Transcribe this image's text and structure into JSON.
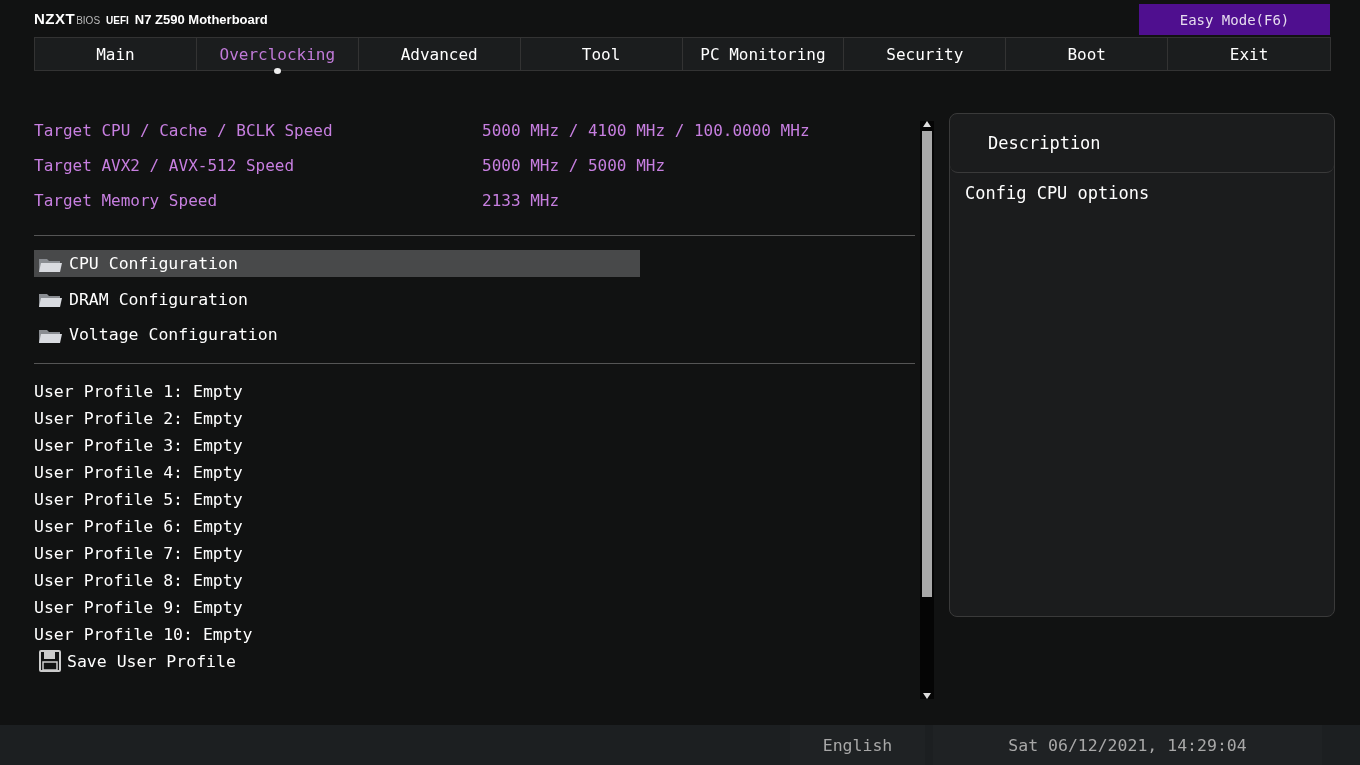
{
  "header": {
    "brand": "NZXT",
    "bios": "BIOS",
    "uefi": "UEFI",
    "board": "N7 Z590 Motherboard",
    "easy_mode_button": "Easy Mode(F6)"
  },
  "tabs": [
    {
      "label": "Main",
      "selected": false
    },
    {
      "label": "Overclocking",
      "selected": true
    },
    {
      "label": "Advanced",
      "selected": false
    },
    {
      "label": "Tool",
      "selected": false
    },
    {
      "label": "PC Monitoring",
      "selected": false
    },
    {
      "label": "Security",
      "selected": false
    },
    {
      "label": "Boot",
      "selected": false
    },
    {
      "label": "Exit",
      "selected": false
    }
  ],
  "info_rows": [
    {
      "label": "Target CPU / Cache / BCLK Speed",
      "value": "5000 MHz / 4100 MHz / 100.0000 MHz"
    },
    {
      "label": "Target AVX2 / AVX-512 Speed",
      "value": "5000 MHz / 5000 MHz"
    },
    {
      "label": "Target Memory Speed",
      "value": "2133 MHz"
    }
  ],
  "submenus": [
    {
      "label": "CPU Configuration",
      "selected": true
    },
    {
      "label": "DRAM Configuration",
      "selected": false
    },
    {
      "label": "Voltage Configuration",
      "selected": false
    }
  ],
  "profile_items": [
    {
      "kind": "text",
      "label": "User Profile 1: Empty"
    },
    {
      "kind": "text",
      "label": "User Profile 2: Empty"
    },
    {
      "kind": "text",
      "label": "User Profile 3: Empty"
    },
    {
      "kind": "text",
      "label": "User Profile 4: Empty"
    },
    {
      "kind": "text",
      "label": "User Profile 5: Empty"
    },
    {
      "kind": "text",
      "label": "User Profile 6: Empty"
    },
    {
      "kind": "text",
      "label": "User Profile 7: Empty"
    },
    {
      "kind": "text",
      "label": "User Profile 8: Empty"
    },
    {
      "kind": "text",
      "label": "User Profile 9: Empty"
    },
    {
      "kind": "text",
      "label": "User Profile 10: Empty"
    },
    {
      "kind": "save",
      "label": "Save User Profile"
    }
  ],
  "description": {
    "title": "Description",
    "text": "Config CPU options"
  },
  "status_bar": {
    "language": "English",
    "datetime": "Sat 06/12/2021, 14:29:04"
  }
}
